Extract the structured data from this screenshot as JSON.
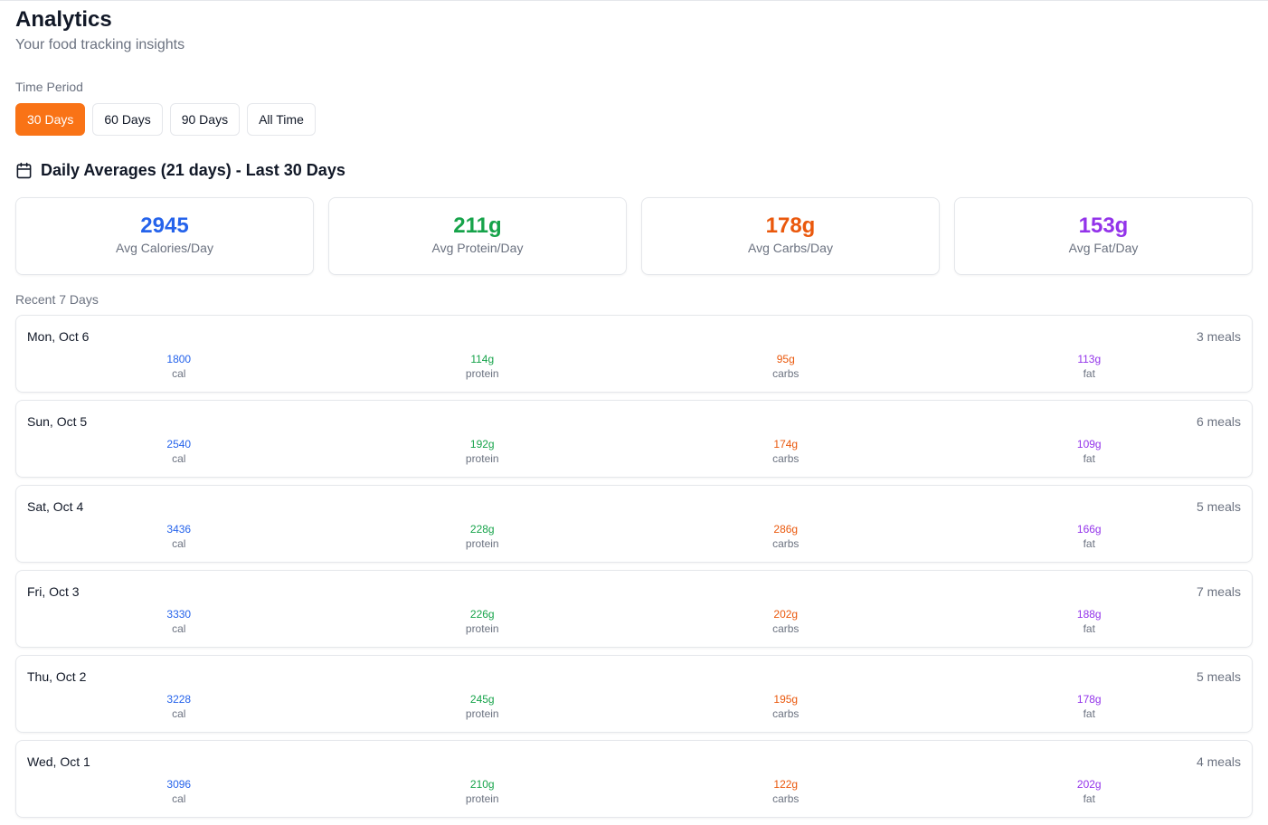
{
  "header": {
    "title": "Analytics",
    "subtitle": "Your food tracking insights"
  },
  "period": {
    "label": "Time Period",
    "options": [
      "30 Days",
      "60 Days",
      "90 Days",
      "All Time"
    ],
    "selected": "30 Days"
  },
  "daily_averages": {
    "icon": "calendar-icon",
    "heading": "Daily Averages (21 days) - Last 30 Days",
    "cards": [
      {
        "value": "2945",
        "label": "Avg Calories/Day",
        "color": "#2563eb"
      },
      {
        "value": "211g",
        "label": "Avg Protein/Day",
        "color": "#16a34a"
      },
      {
        "value": "178g",
        "label": "Avg Carbs/Day",
        "color": "#ea580c"
      },
      {
        "value": "153g",
        "label": "Avg Fat/Day",
        "color": "#9333ea"
      }
    ]
  },
  "recent": {
    "label": "Recent 7 Days",
    "units": {
      "cal": "cal",
      "protein": "protein",
      "carbs": "carbs",
      "fat": "fat"
    },
    "days": [
      {
        "date": "Mon, Oct 6",
        "meals": "3 meals",
        "cal": "1800",
        "protein": "114g",
        "carbs": "95g",
        "fat": "113g"
      },
      {
        "date": "Sun, Oct 5",
        "meals": "6 meals",
        "cal": "2540",
        "protein": "192g",
        "carbs": "174g",
        "fat": "109g"
      },
      {
        "date": "Sat, Oct 4",
        "meals": "5 meals",
        "cal": "3436",
        "protein": "228g",
        "carbs": "286g",
        "fat": "166g"
      },
      {
        "date": "Fri, Oct 3",
        "meals": "7 meals",
        "cal": "3330",
        "protein": "226g",
        "carbs": "202g",
        "fat": "188g"
      },
      {
        "date": "Thu, Oct 2",
        "meals": "5 meals",
        "cal": "3228",
        "protein": "245g",
        "carbs": "195g",
        "fat": "178g"
      },
      {
        "date": "Wed, Oct 1",
        "meals": "4 meals",
        "cal": "3096",
        "protein": "210g",
        "carbs": "122g",
        "fat": "202g"
      }
    ]
  },
  "colors": {
    "accent": "#f97316",
    "calories": "#2563eb",
    "protein": "#16a34a",
    "carbs": "#ea580c",
    "fat": "#9333ea"
  }
}
